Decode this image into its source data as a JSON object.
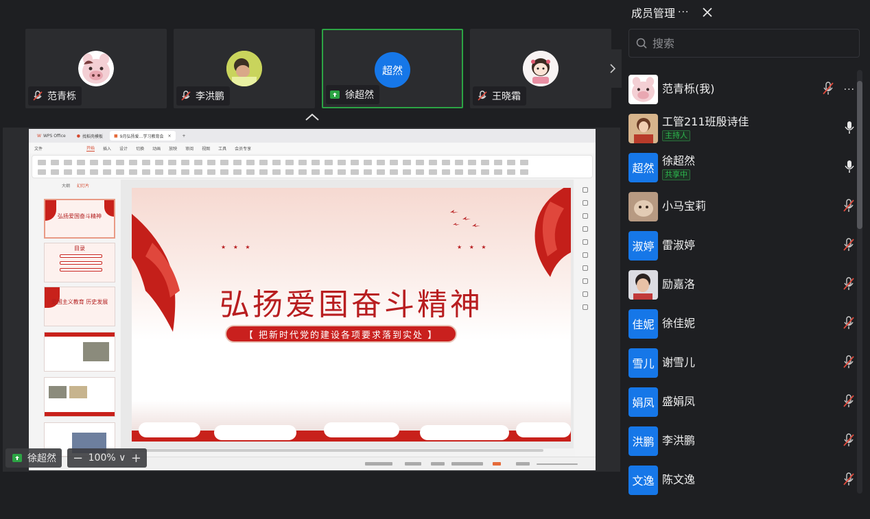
{
  "tiles": [
    {
      "name": "范青栎",
      "mic": "muted"
    },
    {
      "name": "李洪鹏",
      "mic": "muted"
    },
    {
      "name": "徐超然",
      "mic": "sharing",
      "avatar_text": "超然"
    },
    {
      "name": "王晓霜",
      "mic": "muted"
    }
  ],
  "shared_screen": {
    "app_tabs": [
      "WPS Office",
      "找稻壳模板",
      "9月弘扬爱…学习教育会"
    ],
    "menu": [
      "文件",
      "开始",
      "插入",
      "设计",
      "切换",
      "动画",
      "放映",
      "审阅",
      "视图",
      "工具",
      "会员专享"
    ],
    "panel_tabs": [
      "大纲",
      "幻灯片"
    ],
    "thumbnails": [
      {
        "num": "1",
        "title": "弘扬爱国奋斗精神"
      },
      {
        "num": "2",
        "title": "目录"
      },
      {
        "num": "3",
        "title": "爱国主义教育 历史发展"
      },
      {
        "num": "4",
        "title": ""
      },
      {
        "num": "5",
        "title": ""
      },
      {
        "num": "6",
        "title": ""
      }
    ],
    "slide_title": "弘扬爱国奋斗精神",
    "slide_subtitle": "【 把新时代党的建设各项要求落到实处 】",
    "stars": "★ ★ ★"
  },
  "presenter": {
    "name": "徐超然"
  },
  "zoom": {
    "minus": "−",
    "value": "100% ∨",
    "plus": "+"
  },
  "panel": {
    "title": "成员管理",
    "more": "···",
    "search_placeholder": "搜索",
    "members": [
      {
        "name": "范青栎(我)",
        "avatar": "pig",
        "badge": "",
        "mic": "muted",
        "more": "···"
      },
      {
        "name": "工管211班殷诗佳",
        "avatar": "photo-girl",
        "badge": "主持人",
        "mic": "on",
        "more": ""
      },
      {
        "name": "徐超然",
        "avatar_text": "超然",
        "badge": "共享中",
        "mic": "on",
        "more": ""
      },
      {
        "name": "小马宝莉",
        "avatar": "photo-cat",
        "badge": "",
        "mic": "muted",
        "more": ""
      },
      {
        "name": "雷淑婷",
        "avatar_text": "淑婷",
        "badge": "",
        "mic": "muted",
        "more": ""
      },
      {
        "name": "励嘉洛",
        "avatar": "photo-boy",
        "badge": "",
        "mic": "muted",
        "more": ""
      },
      {
        "name": "徐佳妮",
        "avatar_text": "佳妮",
        "badge": "",
        "mic": "muted",
        "more": ""
      },
      {
        "name": "谢雪儿",
        "avatar_text": "雪儿",
        "badge": "",
        "mic": "muted",
        "more": ""
      },
      {
        "name": "盛娟凤",
        "avatar_text": "娟凤",
        "badge": "",
        "mic": "muted",
        "more": ""
      },
      {
        "name": "李洪鹏",
        "avatar_text": "洪鹏",
        "badge": "",
        "mic": "muted",
        "more": ""
      },
      {
        "name": "陈文逸",
        "avatar_text": "文逸",
        "badge": "",
        "mic": "muted",
        "more": ""
      }
    ]
  },
  "colors": {
    "accent": "#1677e8",
    "share_green": "#2ca444",
    "slide_red": "#b81e20"
  }
}
